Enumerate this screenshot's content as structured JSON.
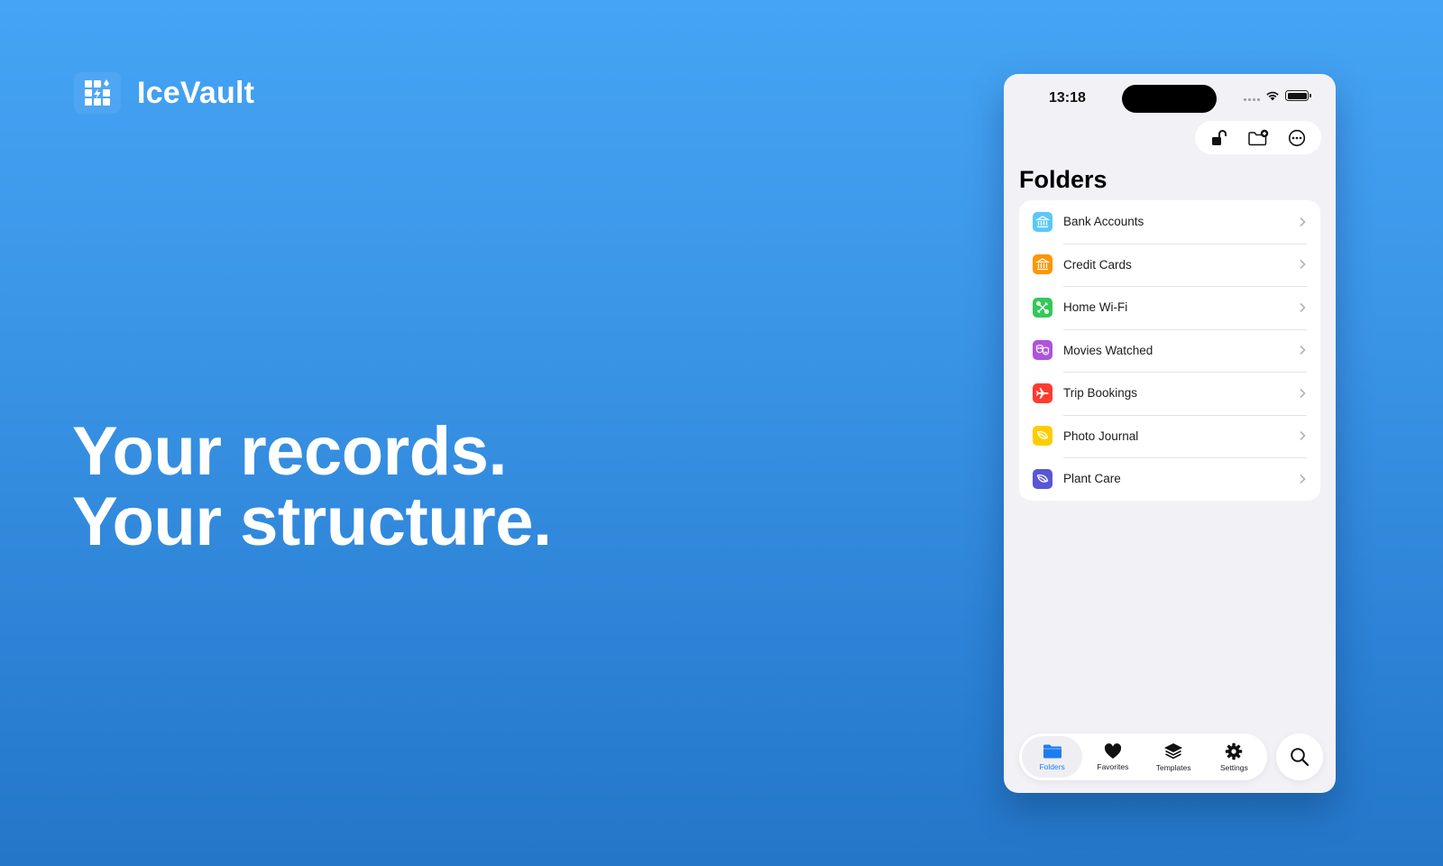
{
  "brand": {
    "name": "IceVault",
    "logo_icon": "grid-bolt-logo-icon"
  },
  "headline": {
    "line1": "Your records.",
    "line2": "Your structure."
  },
  "phone": {
    "status": {
      "time": "13:18",
      "wifi_icon": "wifi-icon",
      "battery_icon": "battery-icon"
    },
    "toolbar": [
      {
        "name": "unlock",
        "icon": "unlock-icon"
      },
      {
        "name": "new-folder",
        "icon": "folder-plus-icon"
      },
      {
        "name": "more",
        "icon": "ellipsis-circle-icon"
      }
    ],
    "title": "Folders",
    "folders": [
      {
        "label": "Bank Accounts",
        "icon": "bank-icon",
        "color": "#5ac8fa"
      },
      {
        "label": "Credit Cards",
        "icon": "bank-icon",
        "color": "#ff9500"
      },
      {
        "label": "Home Wi-Fi",
        "icon": "tools-icon",
        "color": "#34c759"
      },
      {
        "label": "Movies Watched",
        "icon": "theater-masks-icon",
        "color": "#af52de"
      },
      {
        "label": "Trip Bookings",
        "icon": "airplane-icon",
        "color": "#ff3b30"
      },
      {
        "label": "Photo Journal",
        "icon": "leaf-icon",
        "color": "#ffcc00"
      },
      {
        "label": "Plant Care",
        "icon": "leaf-icon",
        "color": "#5856d6"
      }
    ],
    "tabs": [
      {
        "label": "Folders",
        "icon": "folder-icon",
        "active": true
      },
      {
        "label": "Favorites",
        "icon": "heart-icon",
        "active": false
      },
      {
        "label": "Templates",
        "icon": "layers-icon",
        "active": false
      },
      {
        "label": "Settings",
        "icon": "gear-icon",
        "active": false
      }
    ],
    "accent_color": "#1e7cf2"
  }
}
